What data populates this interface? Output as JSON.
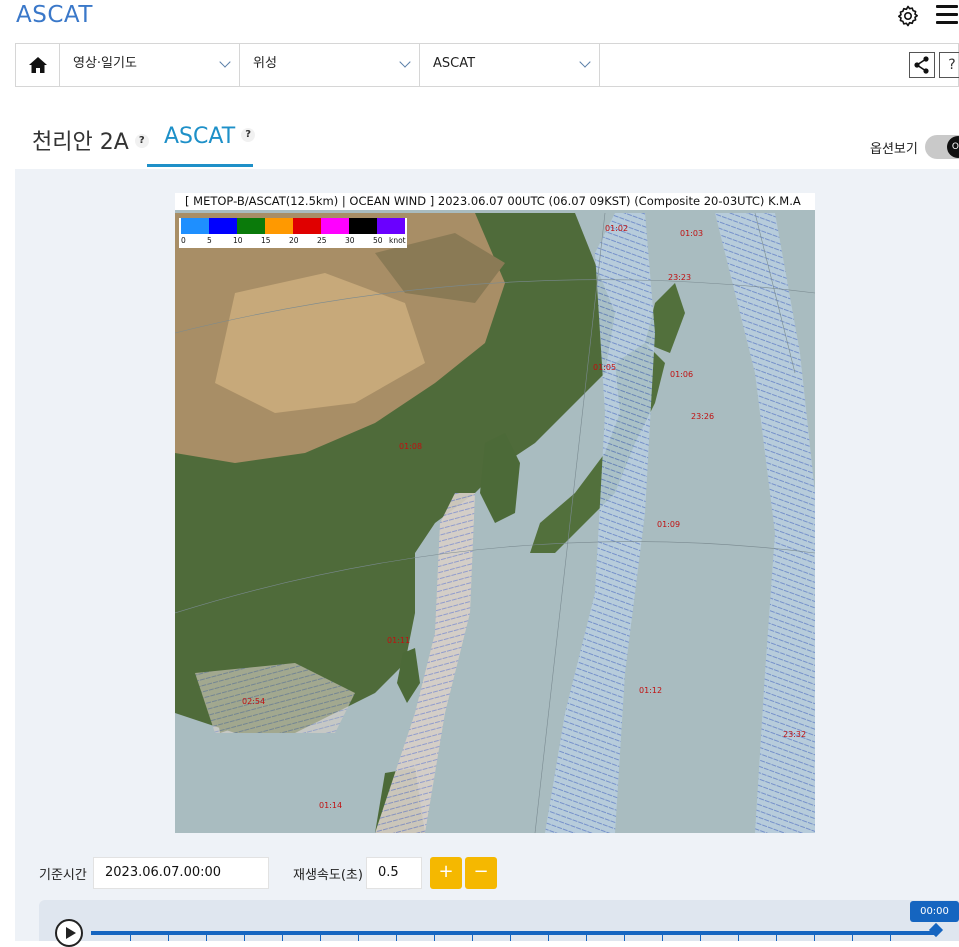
{
  "app": {
    "title": "ASCAT"
  },
  "nav": {
    "home_icon": "home-icon",
    "selects": [
      {
        "value": "영상·일기도"
      },
      {
        "value": "위성"
      },
      {
        "value": "ASCAT"
      }
    ],
    "help_label": "?"
  },
  "tabs": {
    "items": [
      {
        "label": "천리안 2A",
        "help": "?"
      },
      {
        "label": "ASCAT",
        "help": "?"
      }
    ],
    "active": "ASCAT",
    "option_label": "옵션보기",
    "toggle_state": "off",
    "toggle_text": "OF"
  },
  "map": {
    "header": "[ METOP-B/ASCAT(12.5km) | OCEAN WIND ]  2023.06.07 00UTC (06.07 09KST) (Composite 20-03UTC) K.M.A",
    "legend": {
      "colors": [
        "#1e8fff",
        "#0000ff",
        "#0a7a0a",
        "#ff9900",
        "#e00000",
        "#ff00ff",
        "#000000",
        "#6a00ff"
      ],
      "labels": [
        "0",
        "5",
        "10",
        "15",
        "20",
        "25",
        "30",
        "50",
        "knot"
      ]
    },
    "pass_times": [
      "01:02",
      "01:03",
      "23:23",
      "01:05",
      "01:06",
      "23:26",
      "01:08",
      "01:09",
      "01:11",
      "01:12",
      "02:54",
      "23:32",
      "01:14"
    ]
  },
  "controls": {
    "base_time_label": "기준시간",
    "base_time_value": "2023.06.07.00:00",
    "speed_label": "재생속도(초)",
    "speed_value": "0.5",
    "plus": "+",
    "minus": "−",
    "current_time": "00:00"
  }
}
